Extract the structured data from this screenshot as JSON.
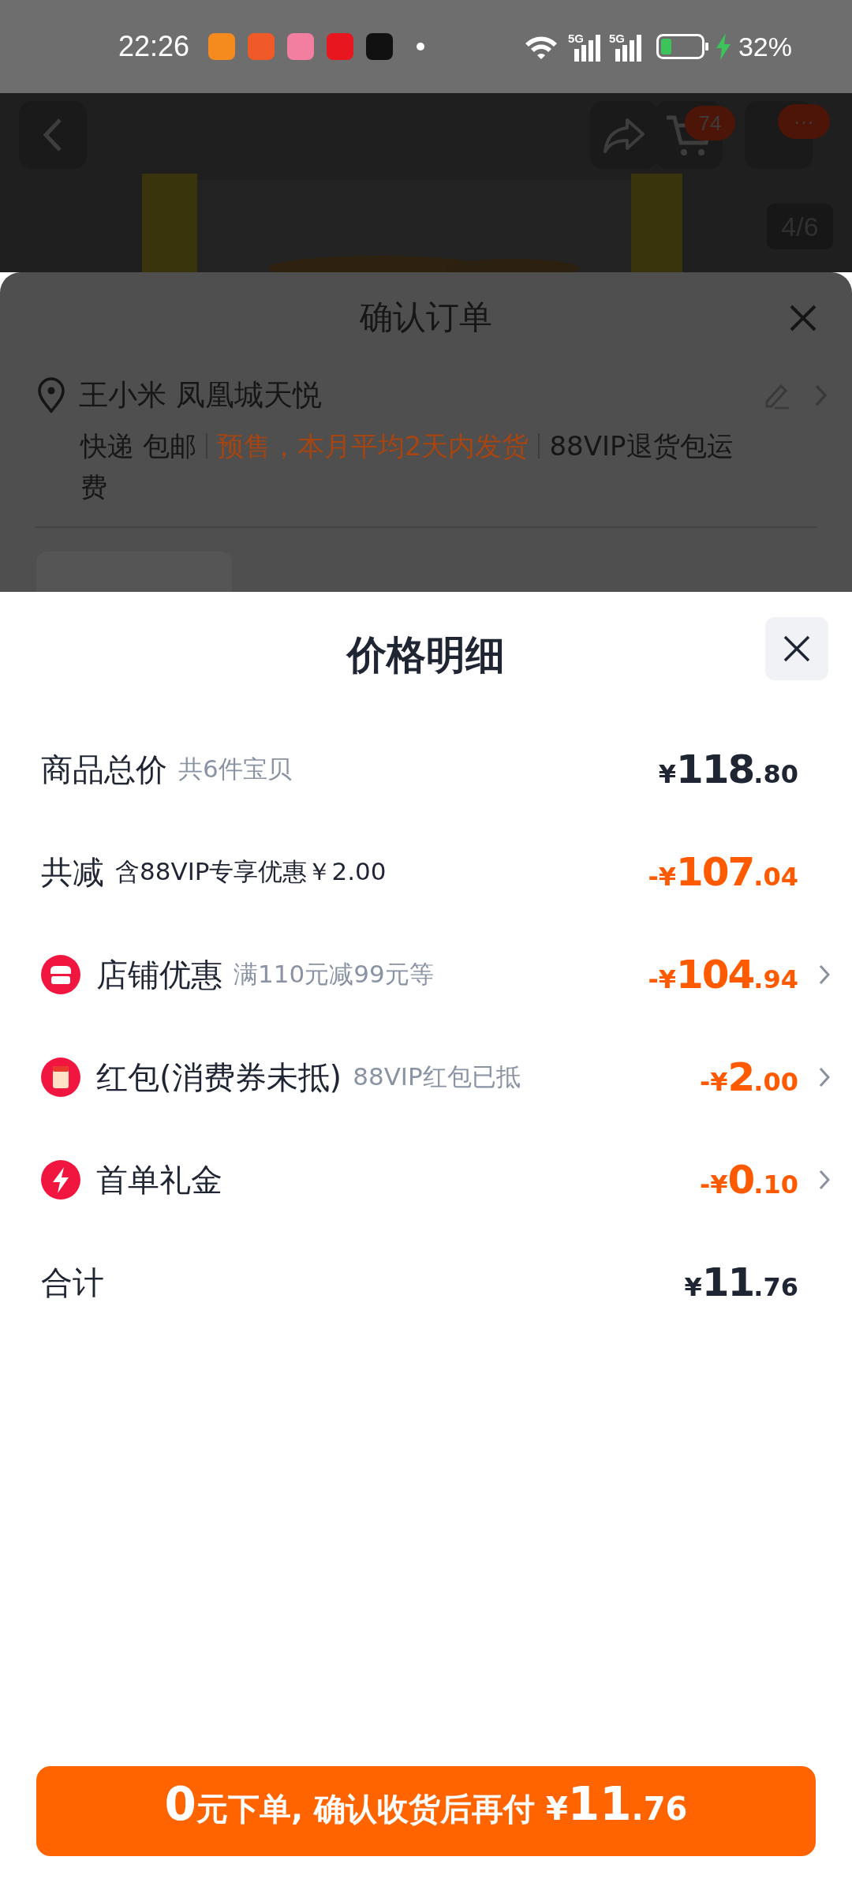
{
  "status_bar": {
    "time": "22:26",
    "notifications": [
      {
        "color": "#f58a1f"
      },
      {
        "color": "#ef5a28"
      },
      {
        "color": "#f27fa0"
      },
      {
        "color": "#e8161e"
      },
      {
        "color": "#111111"
      }
    ],
    "signals": [
      {
        "label": "5G"
      },
      {
        "label": "5G"
      }
    ],
    "charging": true,
    "battery_text": "32%"
  },
  "product_header": {
    "cart_badge": "74",
    "more_badge": "···",
    "image_counter": "4/6"
  },
  "order_sheet": {
    "title": "确认订单",
    "address": "王小米 凤凰城天悦",
    "tags": [
      {
        "text": "快递 包邮",
        "color": "#161616"
      },
      {
        "text": "预售，本月平均2天内发货",
        "color": "#a8440f"
      },
      {
        "text": "88VIP退货包运费",
        "color": "#161616"
      }
    ]
  },
  "price_sheet": {
    "title": "价格明细",
    "rows": [
      {
        "kind": "subtotal",
        "label": "商品总价",
        "note": "共6件宝贝",
        "amount": {
          "prefix": "¥",
          "integer": "118",
          "decimal": ".80"
        },
        "color": "#1f2533",
        "chevron": false
      },
      {
        "kind": "reduction",
        "label": "共减",
        "note": "含88VIP专享优惠￥2.00",
        "amount": {
          "prefix": "-¥",
          "integer": "107",
          "decimal": ".04"
        },
        "color": "#ff5a00",
        "chevron": false
      },
      {
        "kind": "store",
        "label": "店铺优惠",
        "note": "满110元减99元等",
        "amount": {
          "prefix": "-¥",
          "integer": "104",
          "decimal": ".94"
        },
        "color": "#ff5a00",
        "chevron": true
      },
      {
        "kind": "envelope",
        "label": "红包(消费券未抵)",
        "note": "88VIP红包已抵",
        "amount": {
          "prefix": "-¥",
          "integer": "2",
          "decimal": ".00"
        },
        "color": "#ff5a00",
        "chevron": true
      },
      {
        "kind": "bolt",
        "label": "首单礼金",
        "amount": {
          "prefix": "-¥",
          "integer": "0",
          "decimal": ".10"
        },
        "color": "#ff5a00",
        "chevron": true
      },
      {
        "kind": "total",
        "label": "合计",
        "amount": {
          "prefix": "¥",
          "integer": "11",
          "decimal": ".76"
        },
        "color": "#1f2533",
        "chevron": false
      }
    ]
  },
  "pay_button": {
    "segments": [
      {
        "text": "0",
        "kind": "big"
      },
      {
        "text": " 元下单, 确认收货后再付 ¥",
        "kind": "normal"
      },
      {
        "text": "11",
        "kind": "big"
      },
      {
        "text": ".76",
        "kind": "normal"
      }
    ]
  }
}
